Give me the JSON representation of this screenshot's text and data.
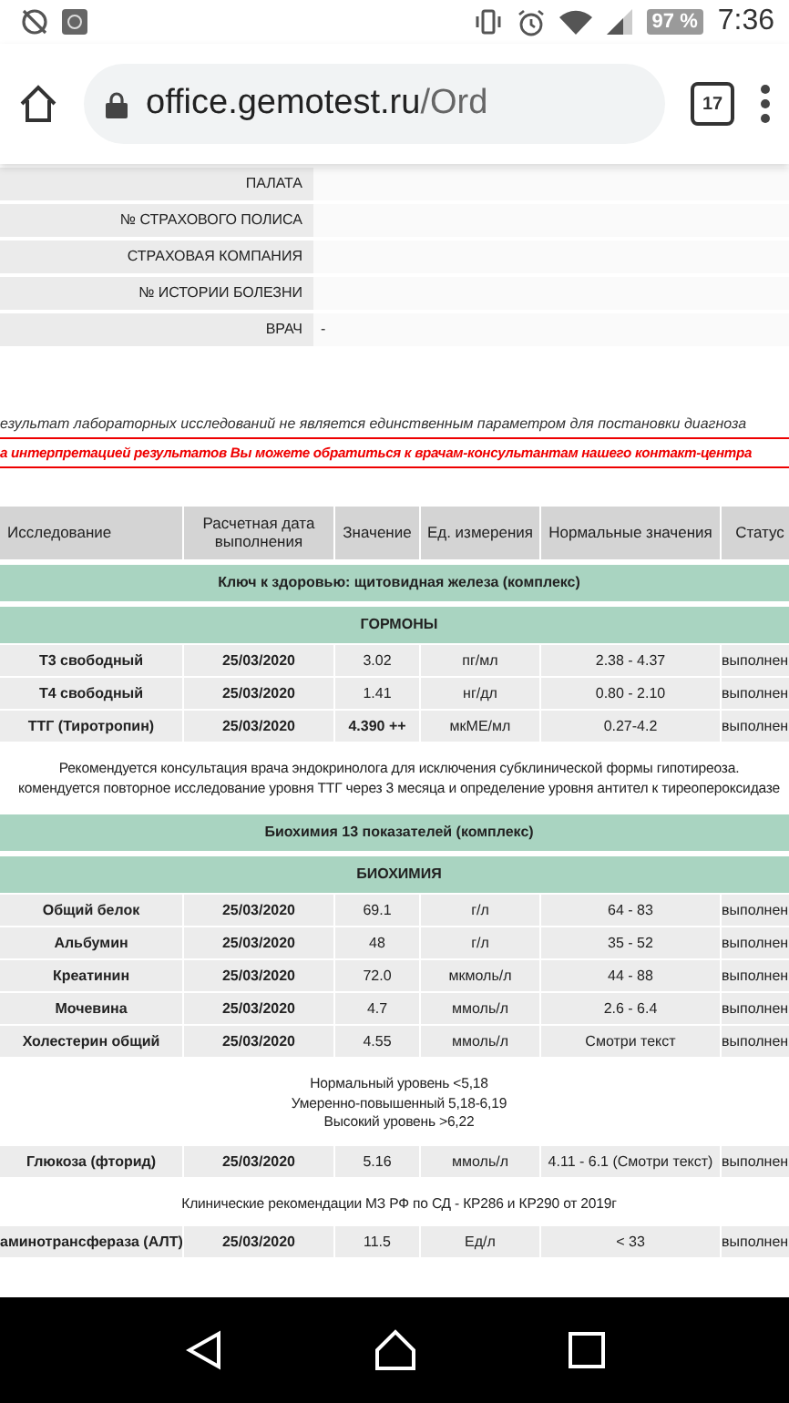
{
  "status_bar": {
    "battery": "97 %",
    "time": "7:36"
  },
  "browser": {
    "url_host": "office.gemotest.ru",
    "url_path": "/Ord",
    "tab_count": "17"
  },
  "patient_info": [
    {
      "label": "ПАЛАТА"
    },
    {
      "label": "№ СТРАХОВОГО ПОЛИСА"
    },
    {
      "label": "СТРАХОВАЯ КОМПАНИЯ"
    },
    {
      "label": "№ ИСТОРИИ БОЛЕЗНИ"
    },
    {
      "label": "ВРАЧ",
      "value": "-"
    }
  ],
  "disclaimer": "езультат лабораторных исследований не является единственным параметром для постановки диагноза",
  "contact_notice": "а интерпретацией результатов Вы можете обратиться к врачам-консультантам нашего контакт-центра",
  "table": {
    "columns": [
      "Исследование",
      "Расчетная дата выполнения",
      "Значение",
      "Ед. измерения",
      "Нормальные значения",
      "Статус"
    ],
    "rows": [
      {
        "kind": "section",
        "text": "Ключ к здоровью: щитовидная железа (комплекс)"
      },
      {
        "kind": "section",
        "text": "ГОРМОНЫ"
      },
      {
        "kind": "result",
        "name": "Т3 свободный",
        "date": "25/03/2020",
        "value": "3.02",
        "flagged": false,
        "unit": "пг/мл",
        "range": "2.38 - 4.37",
        "status": "выполнен"
      },
      {
        "kind": "result",
        "name": "Т4 свободный",
        "date": "25/03/2020",
        "value": "1.41",
        "flagged": false,
        "unit": "нг/дл",
        "range": "0.80 - 2.10",
        "status": "выполнен"
      },
      {
        "kind": "result",
        "name": "ТТГ (Тиротропин)",
        "date": "25/03/2020",
        "value": "4.390 ++",
        "flagged": true,
        "unit": "мкМЕ/мл",
        "range": "0.27-4.2",
        "status": "выполнен"
      },
      {
        "kind": "note",
        "lines": [
          "Рекомендуется консультация врача эндокринолога для исключения субклинической формы гипотиреоза.",
          "комендуется повторное исследование уровня ТТГ через 3 месяца и определение уровня антител к тиреопероксидазе"
        ]
      },
      {
        "kind": "section",
        "text": "Биохимия 13 показателей (комплекс)"
      },
      {
        "kind": "section",
        "text": "БИОХИМИЯ"
      },
      {
        "kind": "result",
        "name": "Общий белок",
        "date": "25/03/2020",
        "value": "69.1",
        "flagged": false,
        "unit": "г/л",
        "range": "64 - 83",
        "status": "выполнен"
      },
      {
        "kind": "result",
        "name": "Альбумин",
        "date": "25/03/2020",
        "value": "48",
        "flagged": false,
        "unit": "г/л",
        "range": "35 - 52",
        "status": "выполнен"
      },
      {
        "kind": "result",
        "name": "Креатинин",
        "date": "25/03/2020",
        "value": "72.0",
        "flagged": false,
        "unit": "мкмоль/л",
        "range": "44 - 88",
        "status": "выполнен"
      },
      {
        "kind": "result",
        "name": "Мочевина",
        "date": "25/03/2020",
        "value": "4.7",
        "flagged": false,
        "unit": "ммоль/л",
        "range": "2.6 - 6.4",
        "status": "выполнен"
      },
      {
        "kind": "result",
        "name": "Холестерин общий",
        "date": "25/03/2020",
        "value": "4.55",
        "flagged": false,
        "unit": "ммоль/л",
        "range": "Смотри текст",
        "status": "выполнен"
      },
      {
        "kind": "note",
        "lines": [
          "Нормальный уровень <5,18",
          "Умеренно-повышенный 5,18-6,19",
          "Высокий уровень >6,22"
        ]
      },
      {
        "kind": "result",
        "name": "Глюкоза (фторид)",
        "date": "25/03/2020",
        "value": "5.16",
        "flagged": false,
        "unit": "ммоль/л",
        "range": "4.11 - 6.1 (Смотри текст)",
        "status": "выполнен"
      },
      {
        "kind": "note",
        "lines": [
          "Клинические рекомендации МЗ РФ по СД - КР286 и КР290 от 2019г"
        ]
      },
      {
        "kind": "result",
        "name": "аминотрансфераза (АЛТ)",
        "date": "25/03/2020",
        "value": "11.5",
        "flagged": false,
        "unit": "Ед/л",
        "range": "< 33",
        "status": "выполнен"
      }
    ]
  }
}
